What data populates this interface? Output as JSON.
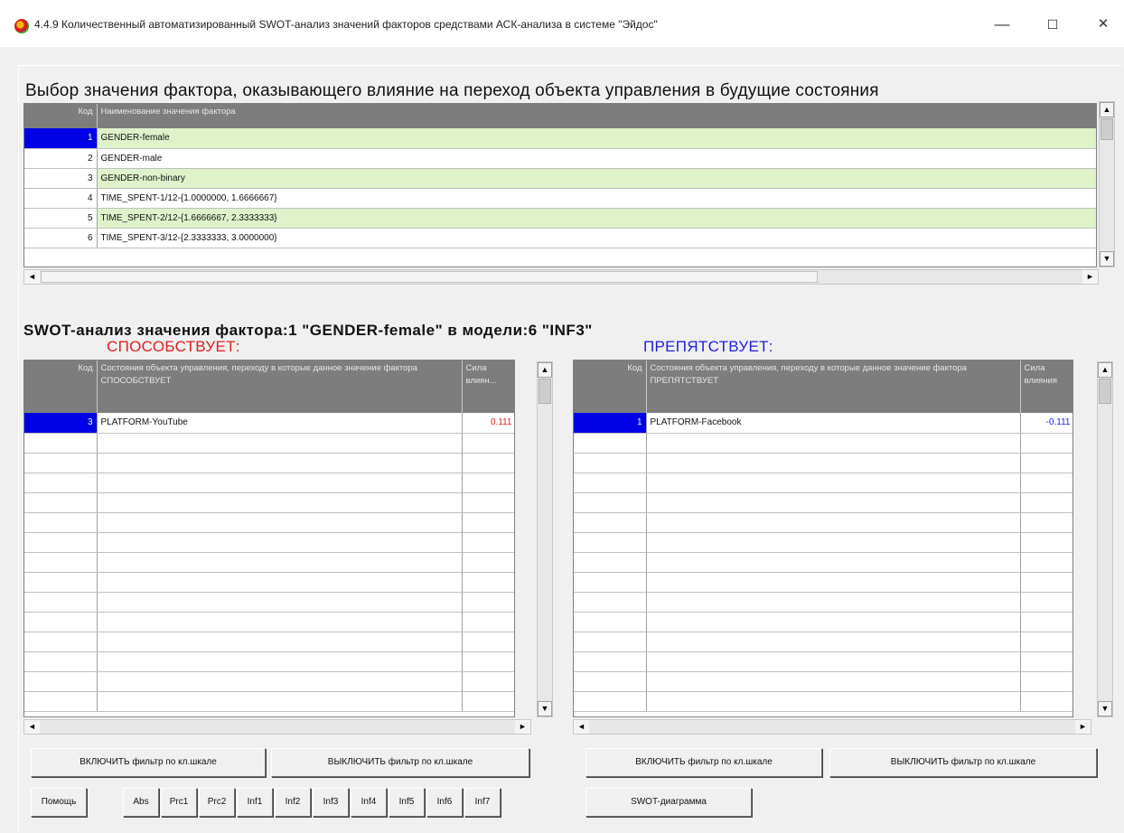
{
  "window": {
    "title": "4.4.9 Количественный автоматизированный SWOT-анализ значений факторов средствами АСК-анализа в системе \"Эйдос\"",
    "min_glyph": "—",
    "max_glyph": "☐",
    "close_glyph": "✕"
  },
  "top": {
    "heading": "Выбор значения фактора, оказывающего влияние на переход объекта управления в будущие состояния",
    "columns": {
      "code": "Код",
      "name": "Наименование значения фактора"
    },
    "rows": [
      {
        "code": "1",
        "name": "GENDER-female"
      },
      {
        "code": "2",
        "name": "GENDER-male"
      },
      {
        "code": "3",
        "name": "GENDER-non-binary"
      },
      {
        "code": "4",
        "name": "TIME_SPENT-1/12-{1.0000000, 1.6666667}"
      },
      {
        "code": "5",
        "name": "TIME_SPENT-2/12-{1.6666667, 2.3333333}"
      },
      {
        "code": "6",
        "name": "TIME_SPENT-3/12-{2.3333333, 3.0000000}"
      }
    ]
  },
  "swot": {
    "heading": "SWOT-анализ значения фактора:1 \"GENDER-female\" в модели:6 \"INF3\"",
    "promotes_label": "СПОСОБСТВУЕТ:",
    "hinders_label": "ПРЕПЯТСТВУЕТ:",
    "left": {
      "columns": {
        "code": "Код",
        "name": "Состояния объекта управления, переходу в которые данное значение фактора СПОСОБСТВУЕТ",
        "strength": "Сила влиян..."
      },
      "rows": [
        {
          "code": "3",
          "name": "PLATFORM-YouTube",
          "strength": "0.111"
        }
      ]
    },
    "right": {
      "columns": {
        "code": "Код",
        "name": "Состояния объекта управления, переходу в которые данное значение фактора ПРЕПЯТСТВУЕТ",
        "strength": "Сила влияния"
      },
      "rows": [
        {
          "code": "1",
          "name": "PLATFORM-Facebook",
          "strength": "-0.111"
        }
      ]
    }
  },
  "buttons": {
    "filter_on": "ВКЛЮЧИТЬ фильтр по кл.шкале",
    "filter_off": "ВЫКЛЮЧИТЬ фильтр по кл.шкале",
    "help": "Помощь",
    "swot_diagram": "SWOT-диаграмма",
    "models": [
      "Abs",
      "Prc1",
      "Prc2",
      "Inf1",
      "Inf2",
      "Inf3",
      "Inf4",
      "Inf5",
      "Inf6",
      "Inf7"
    ]
  },
  "colors": {
    "promotes": "#e02020",
    "hinders": "#2020e0",
    "selected": "#0000e6",
    "alt_row": "#dff2c9"
  },
  "scrollbar_glyphs": {
    "up": "▲",
    "down": "▼",
    "left": "◄",
    "right": "►"
  }
}
